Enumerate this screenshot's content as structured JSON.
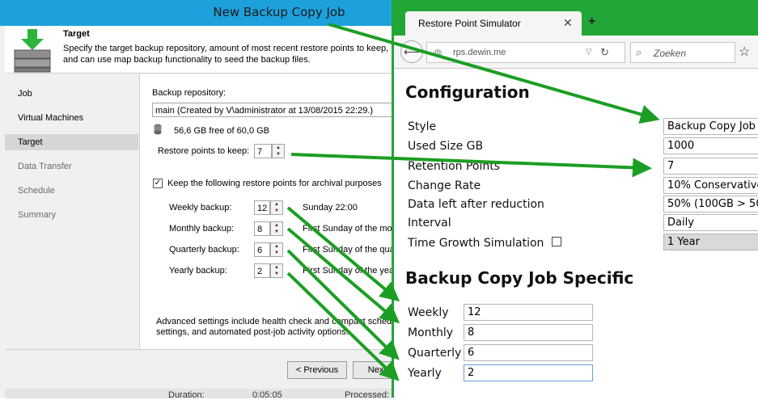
{
  "wizard": {
    "title": "New Backup Copy Job",
    "header_title": "Target",
    "header_desc": "Specify the target backup repository, amount of most recent restore points to keep, and can use map backup functionality to seed the backup files.",
    "nav": [
      "Job",
      "Virtual Machines",
      "Target",
      "Data Transfer",
      "Schedule",
      "Summary"
    ],
    "repository_label": "Backup repository:",
    "repository_value": "main (Created by V\\administrator at 13/08/2015 22:29.)",
    "free_space": "56,6 GB free of 60,0 GB",
    "restore_points_label": "Restore points to keep:",
    "restore_points_value": "7",
    "keep_archival_label": "Keep the following restore points for archival purposes",
    "archival": [
      {
        "label": "Weekly backup:",
        "value": "12",
        "desc": "Sunday 22:00"
      },
      {
        "label": "Monthly backup:",
        "value": "8",
        "desc": "First Sunday of the mon"
      },
      {
        "label": "Quarterly backup:",
        "value": "6",
        "desc": "First Sunday of the qua"
      },
      {
        "label": "Yearly backup:",
        "value": "2",
        "desc": "First Sunday of the year"
      }
    ],
    "advanced_text_1": "Advanced settings include health check and compact schedu",
    "advanced_text_2": "settings, and automated post-job activity options.",
    "previous_label": "< Previous",
    "next_label": "Next",
    "bottom_duration": "Duration:",
    "bottom_duration_val": "0:05:05",
    "bottom_processed": "Processed:"
  },
  "browser": {
    "tab_title": "Restore Point Simulator",
    "url": "rps.dewin.me",
    "search_placeholder": "Zoeken",
    "config_heading": "Configuration",
    "fields": [
      {
        "label": "Style",
        "value": "Backup Copy Job"
      },
      {
        "label": "Used Size GB",
        "value": "1000"
      },
      {
        "label": "Retention Points",
        "value": "7"
      },
      {
        "label": "Change Rate",
        "value": "10% Conservative"
      },
      {
        "label": "Data left after reduction",
        "value": "50% (100GB > 50"
      },
      {
        "label": "Interval",
        "value": "Daily"
      },
      {
        "label": "Time Growth Simulation",
        "value": "1 Year"
      }
    ],
    "copy_heading": "Backup Copy Job Specific",
    "copy_fields": [
      {
        "label": "Weekly",
        "value": "12"
      },
      {
        "label": "Monthly",
        "value": "8"
      },
      {
        "label": "Quarterly",
        "value": "6"
      },
      {
        "label": "Yearly",
        "value": "2"
      }
    ]
  },
  "colors": {
    "arrow": "#1c9e24",
    "titlebar": "#1da1dd",
    "browser_frame": "#23a638"
  }
}
